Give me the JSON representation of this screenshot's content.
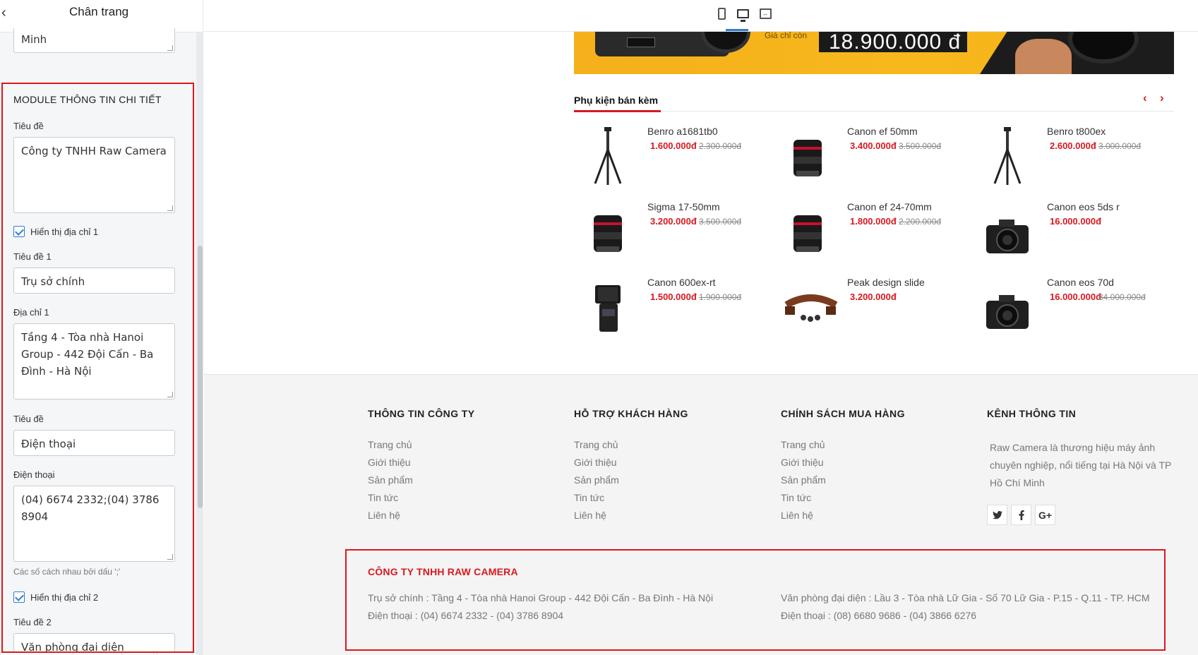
{
  "sidebar": {
    "title": "Chân trang",
    "top_value": "Minh",
    "module_title": "MODULE THÔNG TIN CHI TIẾT",
    "fields": {
      "tieu_de_label": "Tiêu đề",
      "tieu_de_value": "Công ty TNHH Raw Camera",
      "show_address1_label": "Hiển thị địa chỉ 1",
      "title1_label": "Tiêu đề 1",
      "title1_value": "Trụ sở chính",
      "address1_label": "Địa chỉ 1",
      "address1_value": "Tầng 4 - Tòa nhà Hanoi Group - 442 Đội Cấn - Ba Đình - Hà Nội",
      "phone_title_label": "Tiêu đề",
      "phone_title_value": "Điện thoại",
      "phone_label": "Điện thoại",
      "phone_value": "(04) 6674 2332;(04) 3786 8904",
      "phone_hint": "Các số cách nhau bởi dấu ';'",
      "show_address2_label": "Hiển thị địa chỉ 2",
      "title2_label": "Tiêu đề 2",
      "title2_value": "Văn phòng đại diện"
    }
  },
  "toolbar": {
    "devices": [
      "mobile-icon",
      "desktop-icon",
      "fullwidth-icon"
    ],
    "active": "desktop"
  },
  "banner": {
    "price": "18.900.000 đ",
    "caption": "Giá chỉ còn"
  },
  "accessories": {
    "title": "Phụ kiện bán kèm",
    "prev": "‹",
    "next": "›",
    "products": [
      {
        "name": "Benro a1681tb0",
        "price": "1.600.000đ",
        "old": "2.300.000đ",
        "icon": "tripod"
      },
      {
        "name": "Canon ef 50mm",
        "price": "3.400.000đ",
        "old": "3.500.000đ",
        "icon": "lens"
      },
      {
        "name": "Benro t800ex",
        "price": "2.600.000đ",
        "old": "3.000.000đ",
        "icon": "tripod"
      },
      {
        "name": "Sigma 17-50mm",
        "price": "3.200.000đ",
        "old": "3.500.000đ",
        "icon": "lens"
      },
      {
        "name": "Canon ef 24-70mm",
        "price": "1.800.000đ",
        "old": "2.200.000đ",
        "icon": "lens"
      },
      {
        "name": "Canon eos 5ds r",
        "price": "16.000.000đ",
        "old": "",
        "icon": "camera"
      },
      {
        "name": "Canon 600ex-rt",
        "price": "1.500.000đ",
        "old": "1.900.000đ",
        "icon": "flash"
      },
      {
        "name": "Peak design slide",
        "price": "3.200.000đ",
        "old": "",
        "icon": "strap"
      },
      {
        "name": "Canon eos 70d",
        "price": "16.000.000đ",
        "old": "34.000.000đ",
        "icon": "camera"
      }
    ]
  },
  "footer": {
    "columns": [
      {
        "title": "THÔNG TIN CÔNG TY",
        "links": [
          "Trang chủ",
          "Giới thiệu",
          "Sản phẩm",
          "Tin tức",
          "Liên hệ"
        ]
      },
      {
        "title": "HỖ TRỢ KHÁCH HÀNG",
        "links": [
          "Trang chủ",
          "Giới thiệu",
          "Sản phẩm",
          "Tin tức",
          "Liên hệ"
        ]
      },
      {
        "title": "CHÍNH SÁCH MUA HÀNG",
        "links": [
          "Trang chủ",
          "Giới thiệu",
          "Sản phẩm",
          "Tin tức",
          "Liên hệ"
        ]
      }
    ],
    "channel": {
      "title": "KÊNH THÔNG TIN",
      "description": "Raw Camera là thương hiệu máy ảnh chuyên nghiệp, nổi tiếng tại Hà Nội và TP Hồ Chí Minh",
      "social": [
        "twitter-icon",
        "facebook-icon",
        "google-plus-icon"
      ]
    },
    "company": {
      "name": "CÔNG TY TNHH RAW CAMERA",
      "address1": "Trụ sở chính : Tầng 4 - Tòa nhà Hanoi Group - 442 Đội Cấn - Ba Đình - Hà Nội",
      "phone1": "Điện thoại : (04) 6674 2332 - (04) 3786 8904",
      "address2": "Văn phòng đại diện : Lầu 3 - Tòa nhà Lữ Gia - Số 70 Lữ Gia - P.15 - Q.11 - TP. HCM",
      "phone2": "Điện thoại : (08) 6680 9686 - (04) 3866 6276"
    }
  },
  "colors": {
    "accent": "#d71920",
    "highlight": "#e0161b",
    "checkbox": "#2f7dd1"
  }
}
